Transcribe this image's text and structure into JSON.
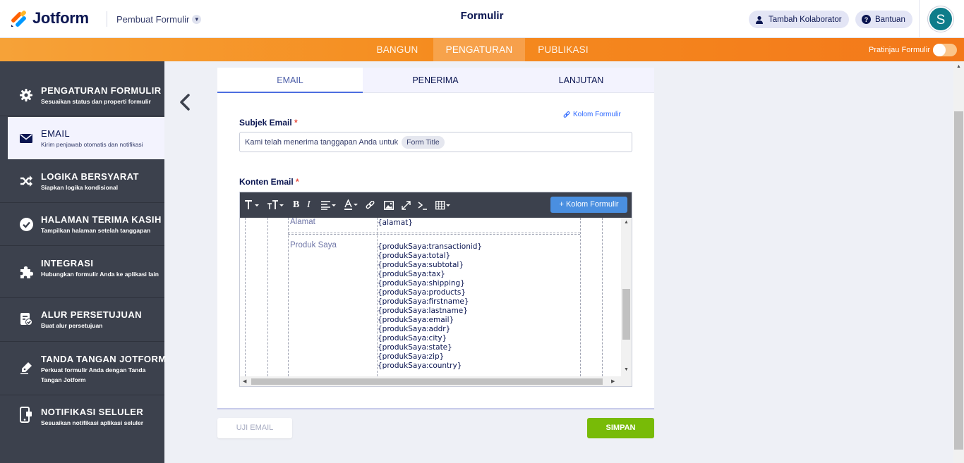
{
  "header": {
    "brand": "Jotform",
    "builder_menu": "Pembuat Formulir",
    "title": "Formulir",
    "collab_button": "Tambah Kolaborator",
    "help_button": "Bantuan",
    "avatar_initial": "S"
  },
  "nav": {
    "tabs": [
      "BANGUN",
      "PENGATURAN",
      "PUBLIKASI"
    ],
    "active": "PENGATURAN",
    "preview_label": "Pratinjau Formulir"
  },
  "sidebar": {
    "items": [
      {
        "title": "PENGATURAN FORMULIR",
        "desc": "Sesuaikan status dan properti formulir",
        "icon": "gear-icon"
      },
      {
        "title": "EMAIL",
        "desc": "Kirim penjawab otomatis dan notifikasi",
        "icon": "envelope-icon"
      },
      {
        "title": "LOGIKA BERSYARAT",
        "desc": "Siapkan logika kondisional",
        "icon": "shuffle-icon"
      },
      {
        "title": "HALAMAN TERIMA KASIH",
        "desc": "Tampilkan halaman setelah tanggapan",
        "icon": "check-circle-icon"
      },
      {
        "title": "INTEGRASI",
        "desc": "Hubungkan formulir Anda ke aplikasi lain",
        "icon": "puzzle-icon"
      },
      {
        "title": "ALUR PERSETUJUAN",
        "desc": "Buat alur persetujuan",
        "icon": "approval-icon"
      },
      {
        "title": "TANDA TANGAN JOTFORM",
        "desc": "Perkuat formulir Anda dengan Tanda Tangan Jotform",
        "icon": "pen-icon"
      },
      {
        "title": "NOTIFIKASI SELULER",
        "desc": "Sesuaikan notifikasi aplikasi seluler",
        "icon": "mobile-icon"
      }
    ],
    "active_index": 1
  },
  "panel": {
    "tabs": [
      "EMAIL",
      "PENERIMA",
      "LANJUTAN"
    ],
    "kolom_link": "Kolom Formulir",
    "subject_label": "Subjek Email",
    "required_mark": "*",
    "subject_text": "Kami telah menerima tanggapan Anda untuk",
    "subject_tag": "Form Title",
    "content_label": "Konten Email",
    "kolom_button": "+ Kolom Formulir",
    "rows": [
      {
        "label": "Alamat",
        "values": [
          "{alamat}"
        ]
      },
      {
        "label": "Produk Saya",
        "values": [
          "{produkSaya:transactionid}",
          "{produkSaya:total}",
          "{produkSaya:subtotal}",
          "{produkSaya:tax}",
          "{produkSaya:shipping}",
          "{produkSaya:products}",
          "{produkSaya:firstname}",
          "{produkSaya:lastname}",
          "{produkSaya:email}",
          "{produkSaya:addr}",
          "{produkSaya:city}",
          "{produkSaya:state}",
          "{produkSaya:zip}",
          "{produkSaya:country}"
        ]
      }
    ]
  },
  "footer": {
    "test_button": "UJI EMAIL",
    "save_button": "SIMPAN"
  },
  "colors": {
    "brand_orange": "#f58c1f",
    "sidebar_bg": "#3c414d",
    "save_green": "#78bb07",
    "link_blue": "#4a8fe0"
  }
}
